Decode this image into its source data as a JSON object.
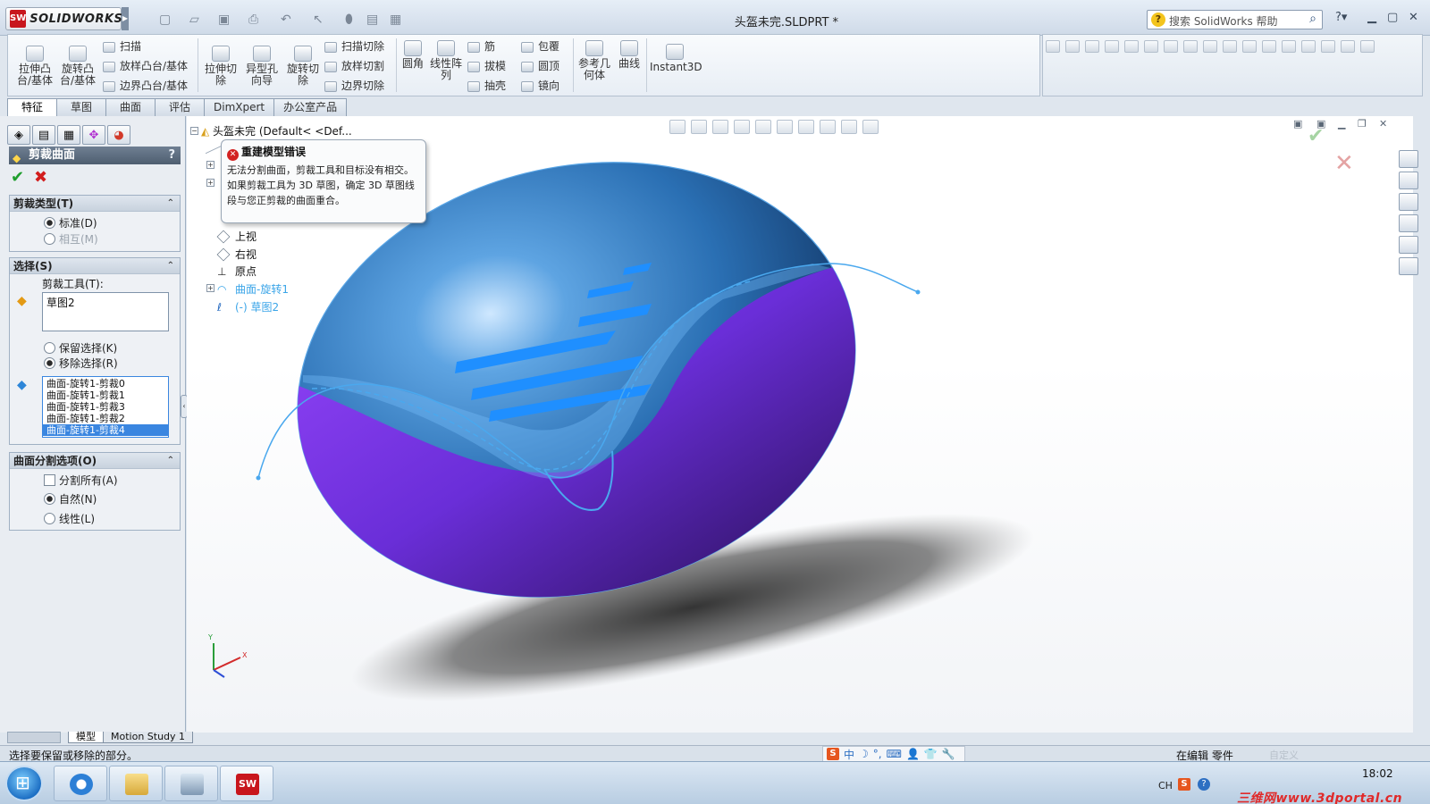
{
  "app": {
    "logo_text": "SOLIDWORKS",
    "document_title": "头盔未完.SLDPRT *",
    "help_search_placeholder": "搜索 SolidWorks 帮助"
  },
  "ribbon": {
    "big_buttons": [
      {
        "label": "拉伸凸\n台/基体"
      },
      {
        "label": "旋转凸\n台/基体"
      },
      {
        "label": "拉伸切\n除"
      },
      {
        "label": "异型孔\n向导"
      },
      {
        "label": "旋转切\n除"
      },
      {
        "label": "圆角"
      },
      {
        "label": "线性阵\n列"
      },
      {
        "label": "参考几\n何体"
      },
      {
        "label": "曲线"
      },
      {
        "label": "Instant3D"
      }
    ],
    "small_col1": [
      "扫描",
      "放样凸台/基体",
      "边界凸台/基体"
    ],
    "small_col2": [
      "扫描切除",
      "放样切割",
      "边界切除"
    ],
    "small_col3": [
      "筋",
      "拔模",
      "抽壳"
    ],
    "small_col4": [
      "包覆",
      "圆顶",
      "镜向"
    ]
  },
  "command_tabs": [
    "特征",
    "草图",
    "曲面",
    "评估",
    "DimXpert",
    "办公室产品"
  ],
  "property_manager": {
    "title": "剪裁曲面",
    "help": "?",
    "trim_type": {
      "header": "剪裁类型(T)",
      "options": [
        "标准(D)",
        "相互(M)"
      ],
      "selected": "标准(D)"
    },
    "selection": {
      "header": "选择(S)",
      "trim_tool_label": "剪裁工具(T):",
      "trim_tool_value": "草图2",
      "keep_option": "保留选择(K)",
      "remove_option": "移除选择(R)",
      "selected": "移除选择(R)",
      "pieces": [
        "曲面-旋转1-剪裁0",
        "曲面-旋转1-剪裁1",
        "曲面-旋转1-剪裁3",
        "曲面-旋转1-剪裁2",
        "曲面-旋转1-剪裁4"
      ],
      "highlighted_piece": "曲面-旋转1-剪裁4"
    },
    "split_options": {
      "header": "曲面分割选项(O)",
      "split_all": "分割所有(A)",
      "split_all_checked": false,
      "natural": "自然(N)",
      "linear": "线性(L)",
      "selected": "自然(N)"
    }
  },
  "feature_tree": {
    "root": "头盔未完  (Default< <Def...",
    "items": [
      "上视",
      "右视",
      "原点",
      "曲面-旋转1",
      "(-) 草图2"
    ]
  },
  "error_tooltip": {
    "title": "重建模型错误",
    "body": "无法分割曲面，剪裁工具和目标没有相交。如果剪裁工具为 3D 草图，确定 3D 草图线段与您正剪裁的曲面重合。"
  },
  "model_colors": {
    "shell_top": "#3b86cc",
    "shell_bottom": "#7a36e8",
    "accent_blue": "#1f8fff",
    "shadow": "#3a3a3a"
  },
  "bottom_tabs": [
    "模型",
    "Motion Study 1"
  ],
  "status": {
    "message": "选择要保留或移除的部分。",
    "ime": "中",
    "mode": "在编辑  零件",
    "custom": "自定义"
  },
  "taskbar": {
    "lang": "CH",
    "time": "18:02",
    "watermark": "三维网www.3dportal.cn"
  }
}
